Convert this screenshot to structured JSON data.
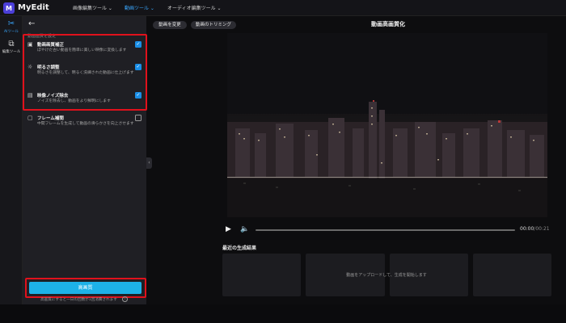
{
  "app": {
    "logo_letter": "M",
    "name": "MyEdit"
  },
  "nav": [
    {
      "label": "画像編集ツール ⌄",
      "active": false
    },
    {
      "label": "動画ツール ⌄",
      "active": true
    },
    {
      "label": "オーディオ編集ツール ⌄",
      "active": false
    }
  ],
  "rail": [
    {
      "icon": "magic-wand-icon",
      "glyph": "✂",
      "label": "AIツール",
      "active": true
    },
    {
      "icon": "layers-icon",
      "glyph": "⧉",
      "label": "編集ツール",
      "active": false
    }
  ],
  "panel": {
    "back_glyph": "←",
    "title": "動画画質を設定",
    "features": [
      {
        "icon": "enhance-icon",
        "glyph": "▣",
        "title": "動画画質補正",
        "desc": "ぼやけた古い動画を簡単に美しい映像に変換します",
        "checked": true
      },
      {
        "icon": "brightness-icon",
        "glyph": "☼",
        "title": "明るさ調整",
        "desc": "明るさを調整して、明るく洗練された動画に仕上げます",
        "checked": true
      },
      {
        "icon": "denoise-icon",
        "glyph": "▤",
        "title": "映像ノイズ除去",
        "desc": "ノイズを除去し、動画をより鮮明にします",
        "checked": true
      },
      {
        "icon": "frame-interpolation-icon",
        "glyph": "▢",
        "title": "フレーム補間",
        "desc": "中間フレームを生成して動画の滑らかさを向上させます",
        "checked": false
      }
    ],
    "enhance_button": "高画質",
    "footnote": "高画質にすると一日の回数が1回消費されます",
    "info_glyph": "i",
    "collapse_glyph": "‹"
  },
  "toolbar": {
    "change_video": "動画を変更",
    "trim_video": "動画のトリミング"
  },
  "main": {
    "title": "動画高画質化"
  },
  "player": {
    "play_glyph": "▶",
    "volume_glyph": "🔈",
    "current_time": "00:00",
    "total_time": "/00:21",
    "progress": 0
  },
  "results": {
    "title": "最近の生成結果",
    "hint": "動画をアップロードして、生成を開始します"
  },
  "colors": {
    "accent": "#1db2e8",
    "highlight": "#e0111c",
    "check": "#1a8ee6",
    "active_nav": "#3aa8ff"
  }
}
